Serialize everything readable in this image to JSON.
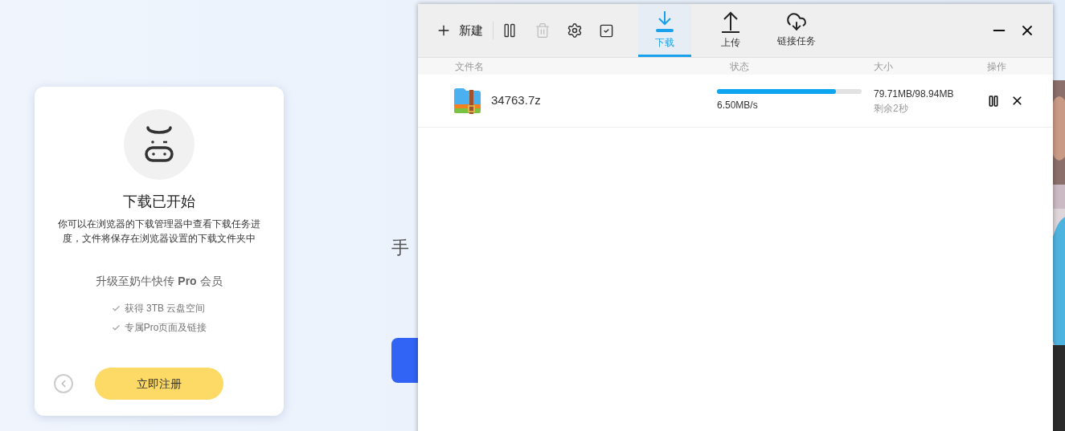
{
  "background_page": {
    "subtitle": "手"
  },
  "dialog": {
    "title": "下载已开始",
    "message": "你可以在浏览器的下载管理器中查看下载任务进度，文件将保存在浏览器设置的下载文件夹中",
    "upgrade": "升级至奶牛快传 **Pro** 会员",
    "benefits": [
      "获得 3TB 云盘空间",
      "专属Pro页面及链接"
    ],
    "register_button": "立即注册"
  },
  "window": {
    "toolbar": {
      "new_label": "新建",
      "tabs": [
        {
          "label": "下载",
          "kind": "download",
          "selected": true
        },
        {
          "label": "上传",
          "kind": "upload",
          "selected": false
        },
        {
          "label": "链接任务",
          "kind": "link",
          "selected": false
        }
      ]
    },
    "table": {
      "columns": [
        "文件名",
        "状态",
        "大小",
        "操作"
      ],
      "rows": [
        {
          "name": "34763.7z",
          "level": 0.82,
          "speed": "6.50MB/s",
          "size": "79.71MB/98.94MB",
          "remaining": "剩余2秒"
        }
      ]
    }
  }
}
